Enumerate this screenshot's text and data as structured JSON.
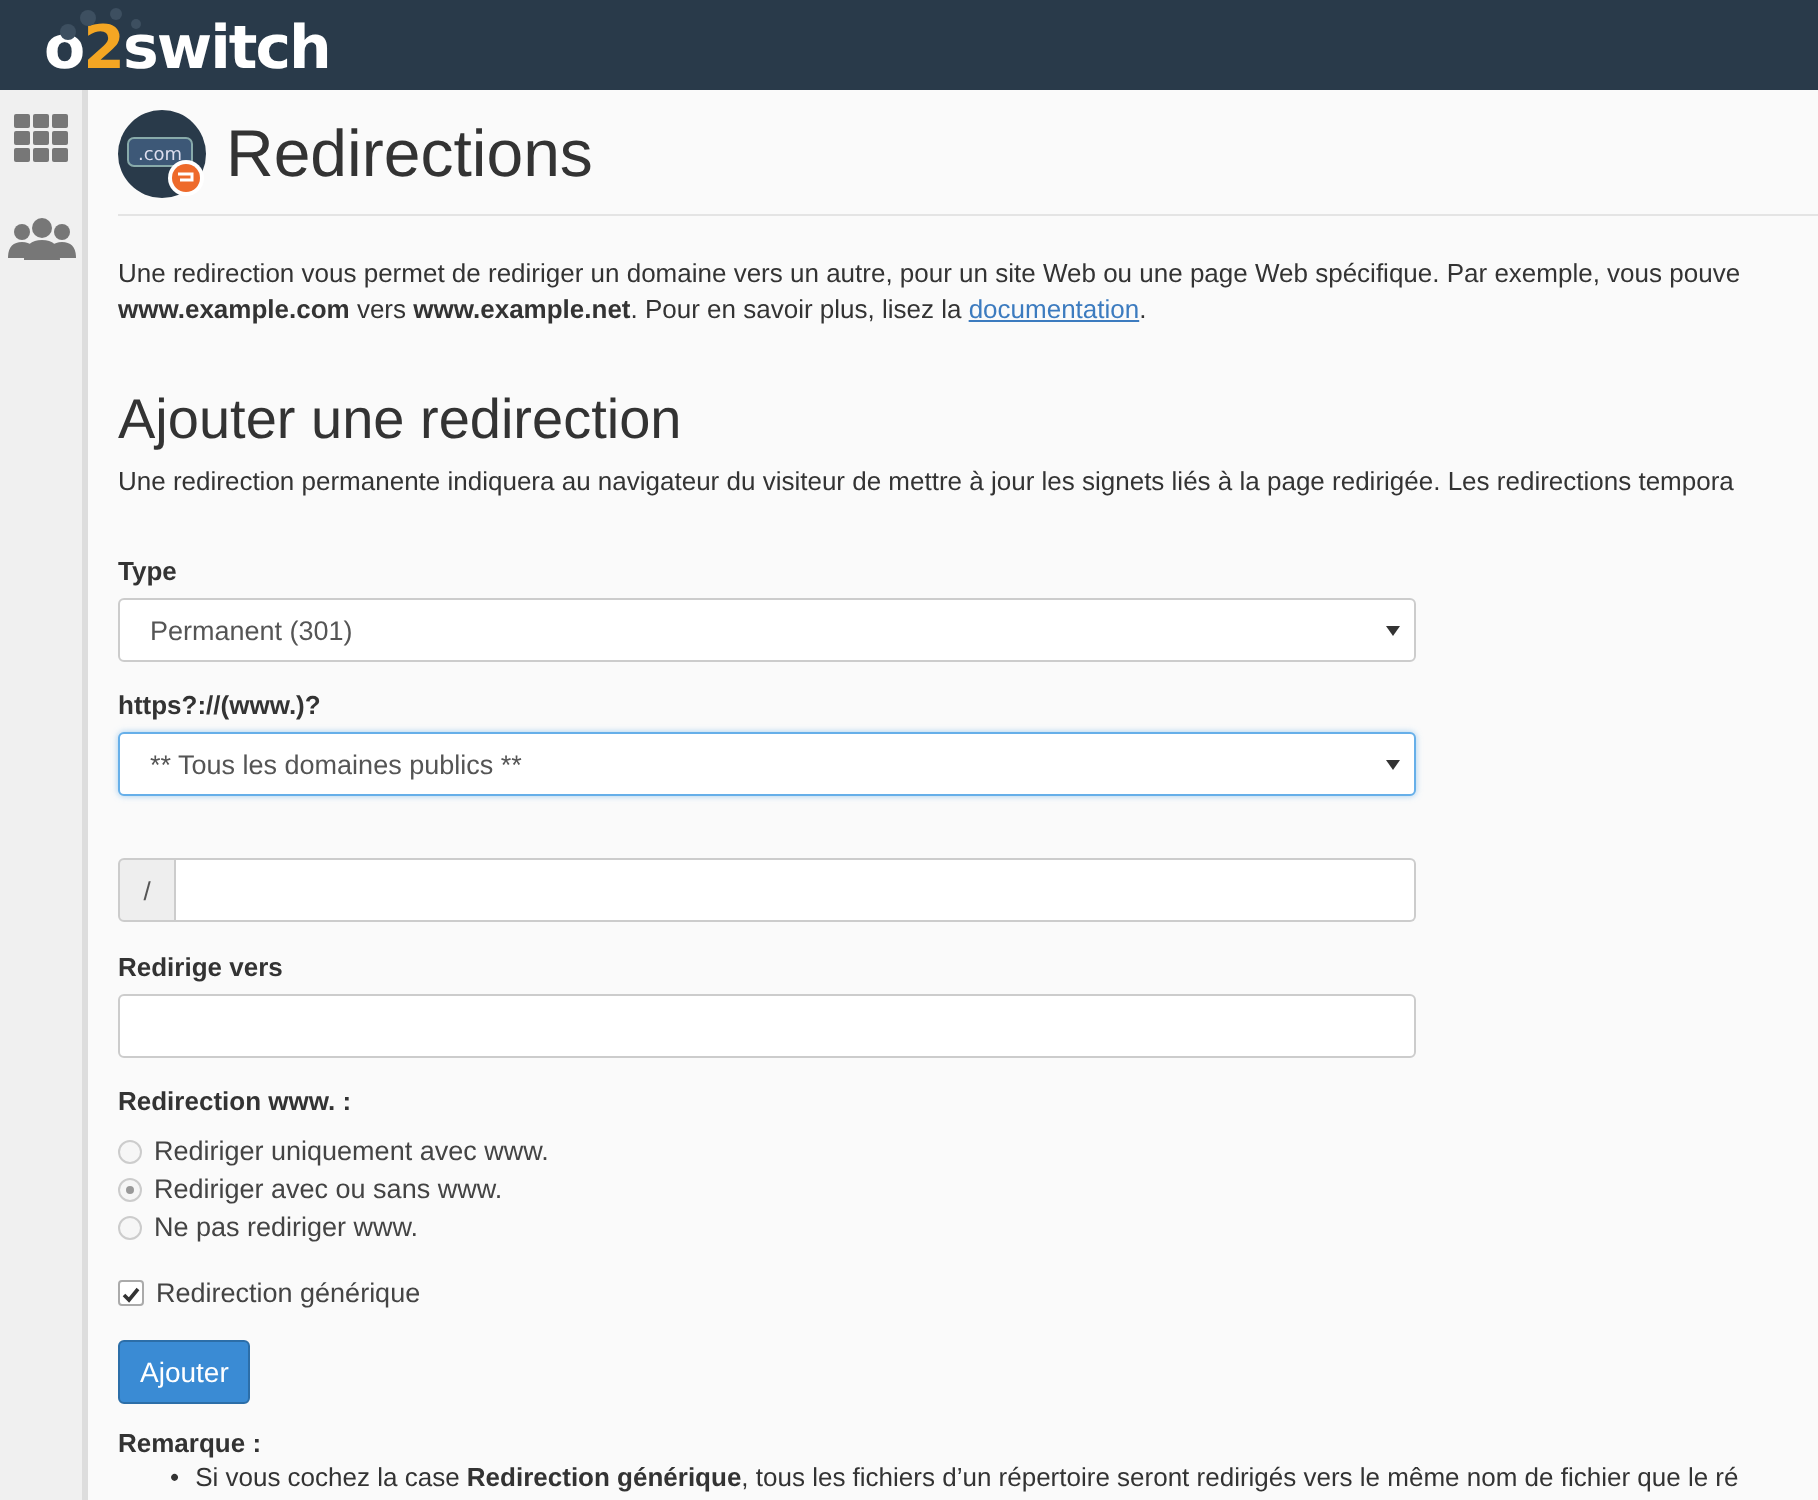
{
  "header": {
    "logo_parts": [
      "o",
      "2",
      "switch"
    ]
  },
  "sidebar": {
    "items": [
      {
        "kind": "grid",
        "selected": false
      },
      {
        "kind": "users",
        "selected": false
      }
    ]
  },
  "page": {
    "title": "Redirections",
    "icon_label": ".com",
    "intro": "Une redirection vous permet de rediriger un domaine vers un autre, pour un site Web ou une page Web spécifique. Par exemple, vous pouve",
    "intro_line2": "**www.example.com** vers **www.example.net**. Pour en savoir plus, lisez la ",
    "intro_link": "documentation",
    "intro_end": ".",
    "section_title": "Ajouter une redirection",
    "section_text": "Une redirection permanente indiquera au navigateur du visiteur de mettre à jour les signets liés à la page redirigée. Les redirections tempora"
  },
  "form": {
    "type_label": "Type",
    "type_value": "Permanent (301)",
    "domain_label": "https?://(www.)?",
    "domain_value": "** Tous les domaines publics **",
    "domain_focused": true,
    "path_prefix": "/",
    "target_label": "Redirige vers",
    "www_label": "Redirection www. :",
    "www_options": [
      {
        "label": "Rediriger uniquement avec www.",
        "selected": false
      },
      {
        "label": "Rediriger avec ou sans www.",
        "selected": true
      },
      {
        "label": "Ne pas rediriger www.",
        "selected": false
      }
    ],
    "wildcard": {
      "label": "Redirection générique",
      "checked": true
    },
    "submit": "Ajouter"
  },
  "notes": {
    "title": "Remarque :",
    "bullet": "•",
    "items": [
      "Si vous cochez la case **Redirection générique**, tous les fichiers d’un répertoire seront redirigés vers le même nom de fichier que le ré"
    ]
  }
}
